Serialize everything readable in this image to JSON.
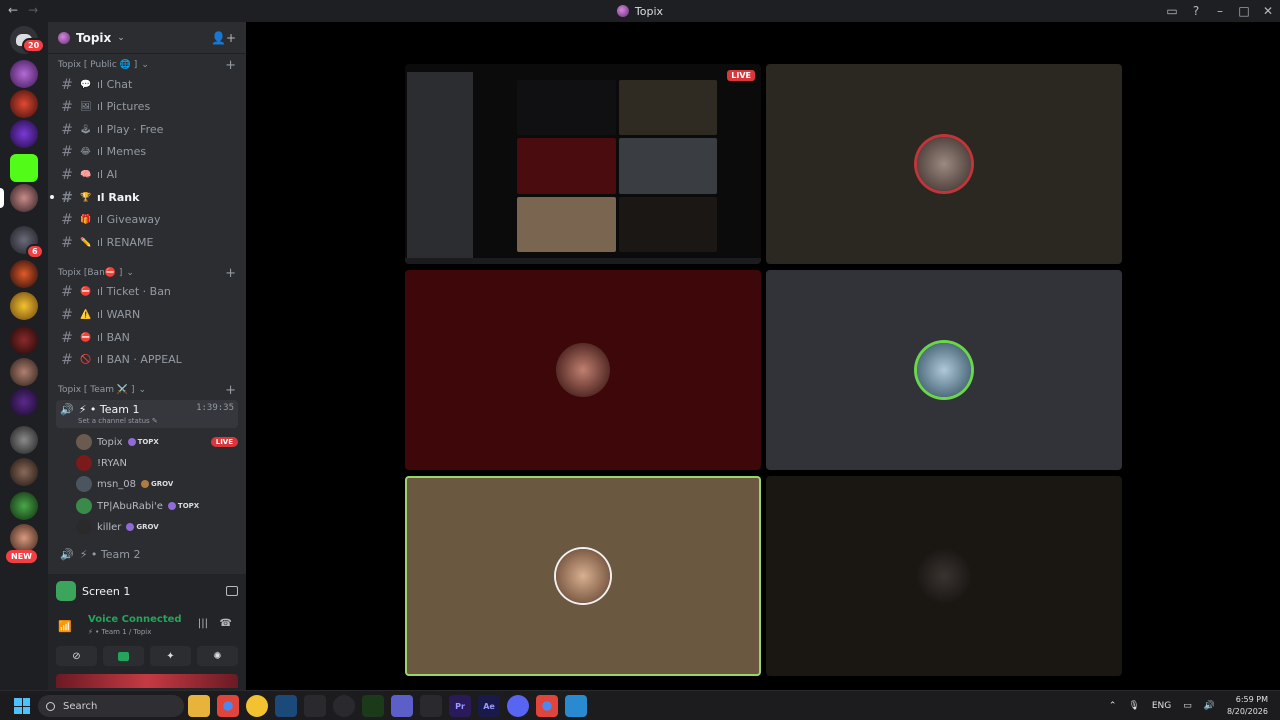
{
  "window": {
    "title": "Topix",
    "nav_back": "←",
    "nav_forward": "→"
  },
  "rail": {
    "dm_badge": "20",
    "badge_2": "6",
    "new_label": "NEW"
  },
  "sidebar": {
    "server_name": "Topix",
    "categories": [
      {
        "label": "Topix [ Public 🌐 ]"
      },
      {
        "label": "Topix [Ban⛔ ]"
      },
      {
        "label": "Topix [ Team ⚔️ ]"
      }
    ],
    "channels_public": [
      {
        "emoji": "💬",
        "label": "ıl Chat"
      },
      {
        "emoji": "🖼",
        "label": "ıl Pictures"
      },
      {
        "emoji": "🕹",
        "label": "ıl Play · Free"
      },
      {
        "emoji": "😂",
        "label": "ıl Memes"
      },
      {
        "emoji": "🧠",
        "label": "ıl AI"
      },
      {
        "emoji": "🏆",
        "label": "ıl Rank"
      },
      {
        "emoji": "🎁",
        "label": "ıl Giveaway"
      },
      {
        "emoji": "✏️",
        "label": "ıl RENAME"
      }
    ],
    "channels_ban": [
      {
        "emoji": "⛔",
        "label": "ıl Ticket · Ban"
      },
      {
        "emoji": "⚠️",
        "label": "ıl WARN"
      },
      {
        "emoji": "⛔",
        "label": "ıl BAN"
      },
      {
        "emoji": "🚫",
        "label": "ıl BAN · APPEAL"
      }
    ],
    "voice_channel": {
      "name": "⚡ • Team 1",
      "timer": "1:39:35",
      "status": "Set a channel status ✎"
    },
    "voice_users": [
      {
        "name": "Topix",
        "tag": "TOPX",
        "live": "LIVE"
      },
      {
        "name": "!RYAN",
        "tag": "",
        "live": ""
      },
      {
        "name": "msn_08",
        "tag": "GROV",
        "live": ""
      },
      {
        "name": "TP|AbuRabi'e",
        "tag": "TOPX",
        "live": ""
      },
      {
        "name": "killer",
        "tag": "GROV",
        "live": ""
      }
    ],
    "voice_channel_2": "⚡ • Team 2"
  },
  "panel": {
    "screen_title": "Screen 1",
    "voice_status": "Voice Connected",
    "voice_sub": "⚡ • Team 1 / Topix"
  },
  "stage": {
    "live_label": "LIVE"
  },
  "taskbar": {
    "search_placeholder": "Search",
    "lang": "ENG",
    "time": "6:59 PM",
    "date": "8/20/2026"
  }
}
